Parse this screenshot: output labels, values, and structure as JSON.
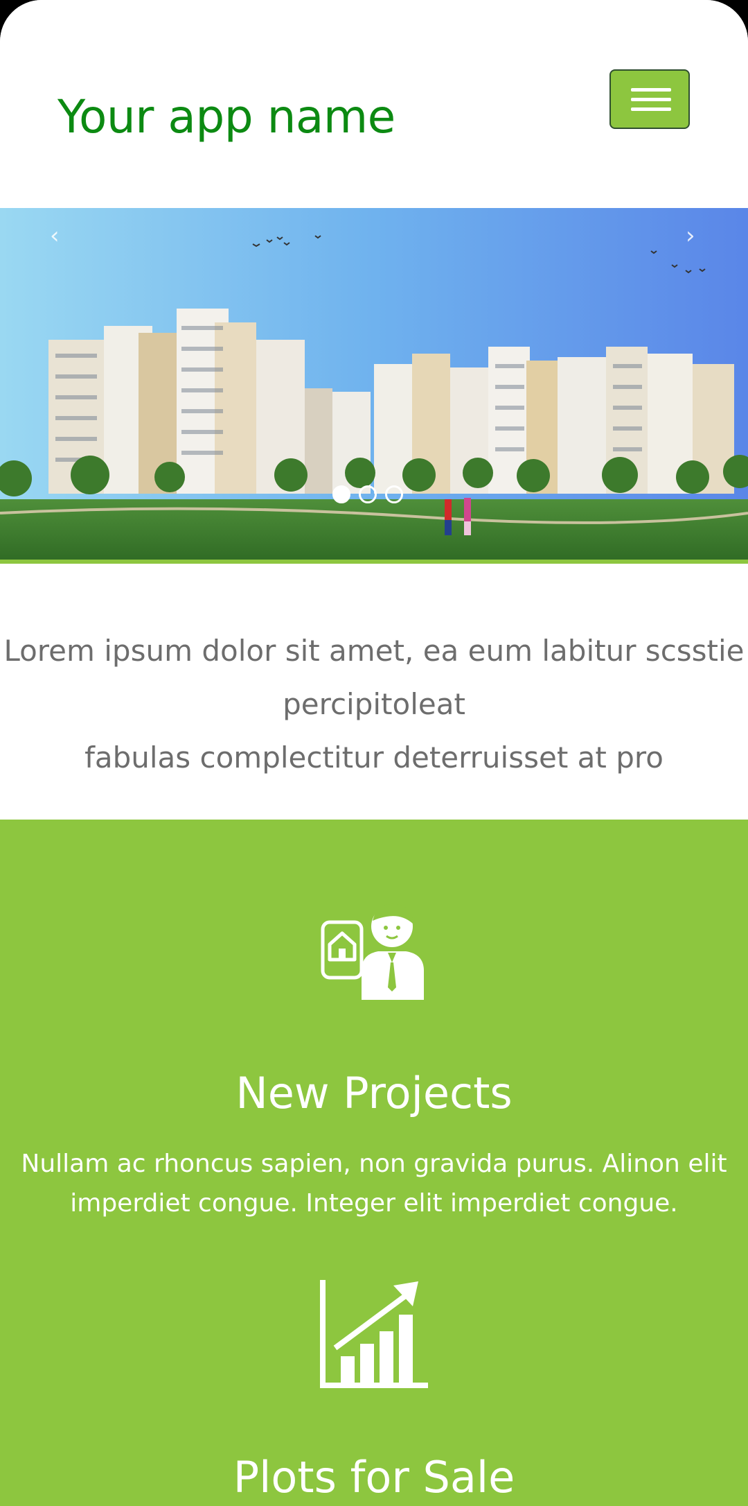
{
  "header": {
    "app_name": "Your app name",
    "menu_icon": "hamburger-menu-icon"
  },
  "carousel": {
    "prev_label": "‹",
    "next_label": "›",
    "slide_count": 3,
    "active_slide": 1,
    "image_subject": "residential apartment towers with garden"
  },
  "intro": {
    "line1": "Lorem ipsum dolor sit amet, ea eum labitur scsstie",
    "line2": "percipitoleat",
    "line3": "fabulas complectitur deterruisset at pro"
  },
  "features": {
    "items": [
      {
        "icon": "agent-with-house-icon",
        "title": "New Projects",
        "desc_line1": "Nullam ac rhoncus sapien, non gravida purus. Alinon elit",
        "desc_line2": "imperdiet congue. Integer elit imperdiet congue."
      },
      {
        "icon": "growth-chart-icon",
        "title": "Plots for Sale"
      }
    ]
  },
  "colors": {
    "brand_green": "#8dc63f",
    "title_green": "#0c8a12",
    "text_gray": "#6d6d6d"
  }
}
